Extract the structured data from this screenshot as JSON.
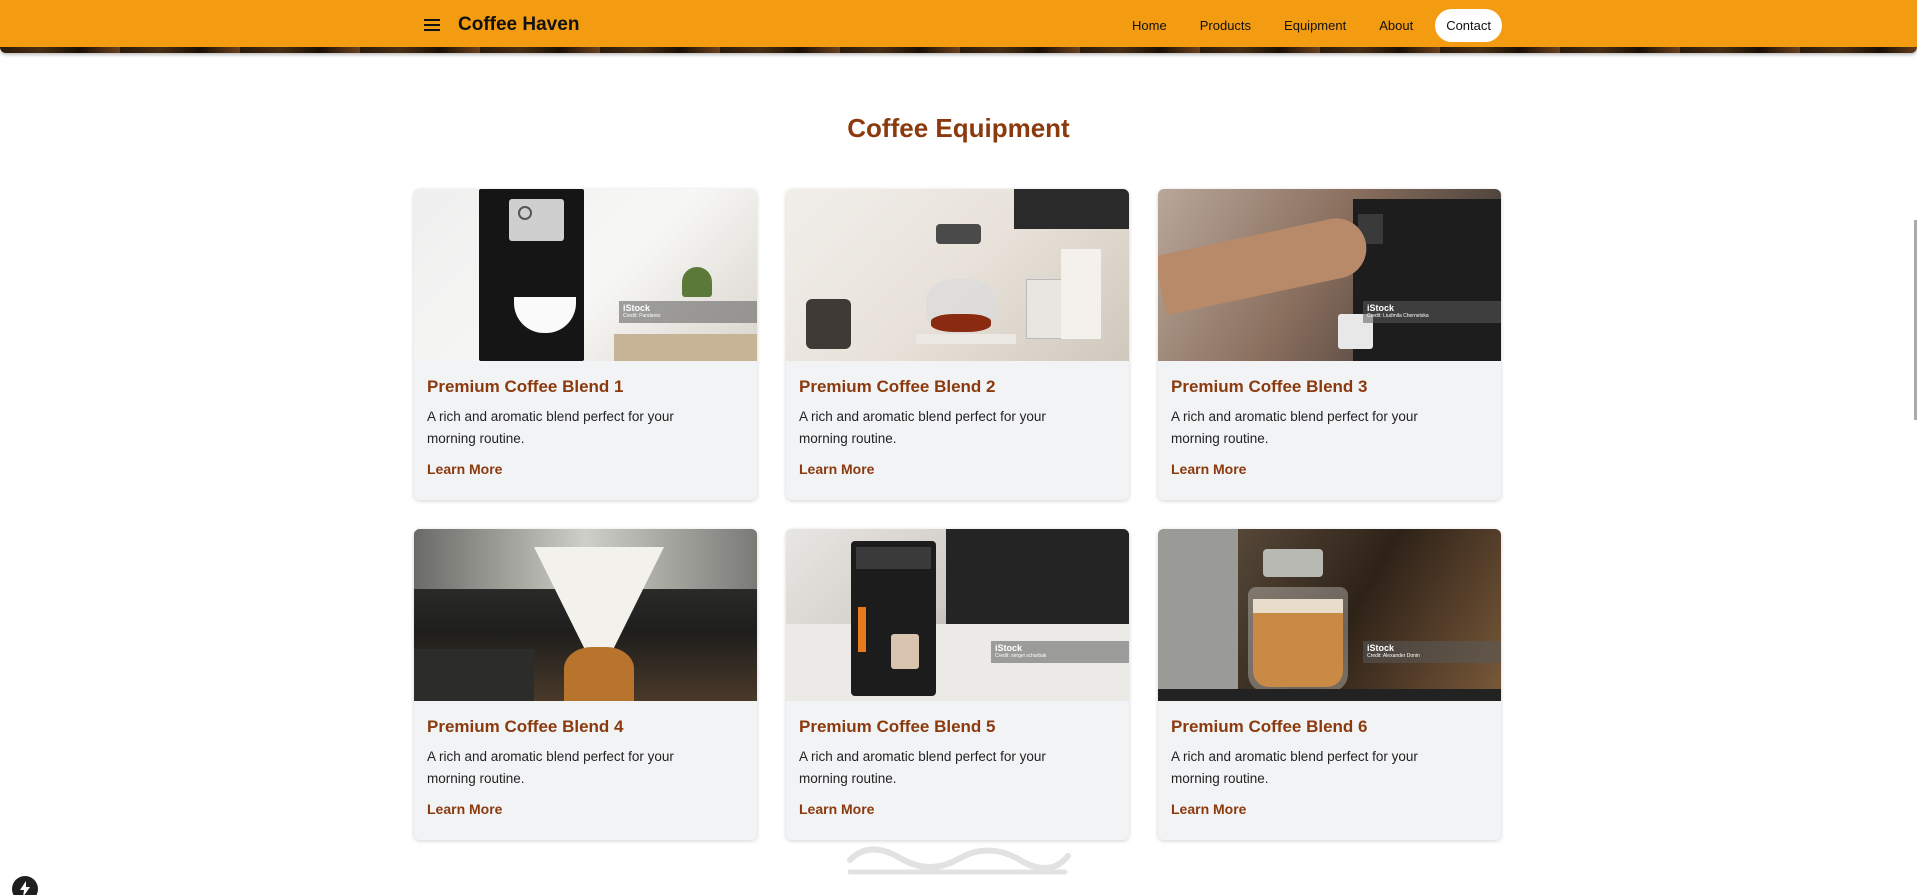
{
  "nav": {
    "brand": "Coffee Haven",
    "links": [
      {
        "label": "Home",
        "active": false
      },
      {
        "label": "Products",
        "active": false
      },
      {
        "label": "Equipment",
        "active": false
      },
      {
        "label": "About",
        "active": false
      },
      {
        "label": "Contact",
        "active": true
      }
    ],
    "menu_icon": "hamburger-menu-icon"
  },
  "colors": {
    "nav_background": "#f39c12",
    "accent_brown": "#8b3a0e",
    "card_background": "#f2f3f5"
  },
  "section": {
    "title": "Coffee Equipment"
  },
  "cards": [
    {
      "title": "Premium Coffee Blend 1",
      "description": "A rich and aromatic blend perfect for your morning routine.",
      "link": "Learn More",
      "image": "espresso-machine-photo",
      "badge": {
        "logo": "iStock",
        "credit": "Credit: Pandarex"
      }
    },
    {
      "title": "Premium Coffee Blend 2",
      "description": "A rich and aromatic blend perfect for your morning routine.",
      "link": "Learn More",
      "image": "pour-over-kettle-photo",
      "badge": null
    },
    {
      "title": "Premium Coffee Blend 3",
      "description": "A rich and aromatic blend perfect for your morning routine.",
      "link": "Learn More",
      "image": "coffee-machine-hand-photo",
      "badge": {
        "logo": "iStock",
        "credit": "Credit: Liudmila Chernetska"
      }
    },
    {
      "title": "Premium Coffee Blend 4",
      "description": "A rich and aromatic blend perfect for your morning routine.",
      "link": "Learn More",
      "image": "chemex-filter-photo",
      "badge": null
    },
    {
      "title": "Premium Coffee Blend 5",
      "description": "A rich and aromatic blend perfect for your morning routine.",
      "link": "Learn More",
      "image": "automatic-coffee-machine-photo",
      "badge": {
        "logo": "iStock",
        "credit": "Credit: sergei scharbak"
      }
    },
    {
      "title": "Premium Coffee Blend 6",
      "description": "A rich and aromatic blend perfect for your morning routine.",
      "link": "Learn More",
      "image": "latte-glass-photo",
      "badge": {
        "logo": "iStock",
        "credit": "Credit: Alexander Donin"
      }
    }
  ],
  "floating_button": {
    "icon": "lightning-icon"
  }
}
